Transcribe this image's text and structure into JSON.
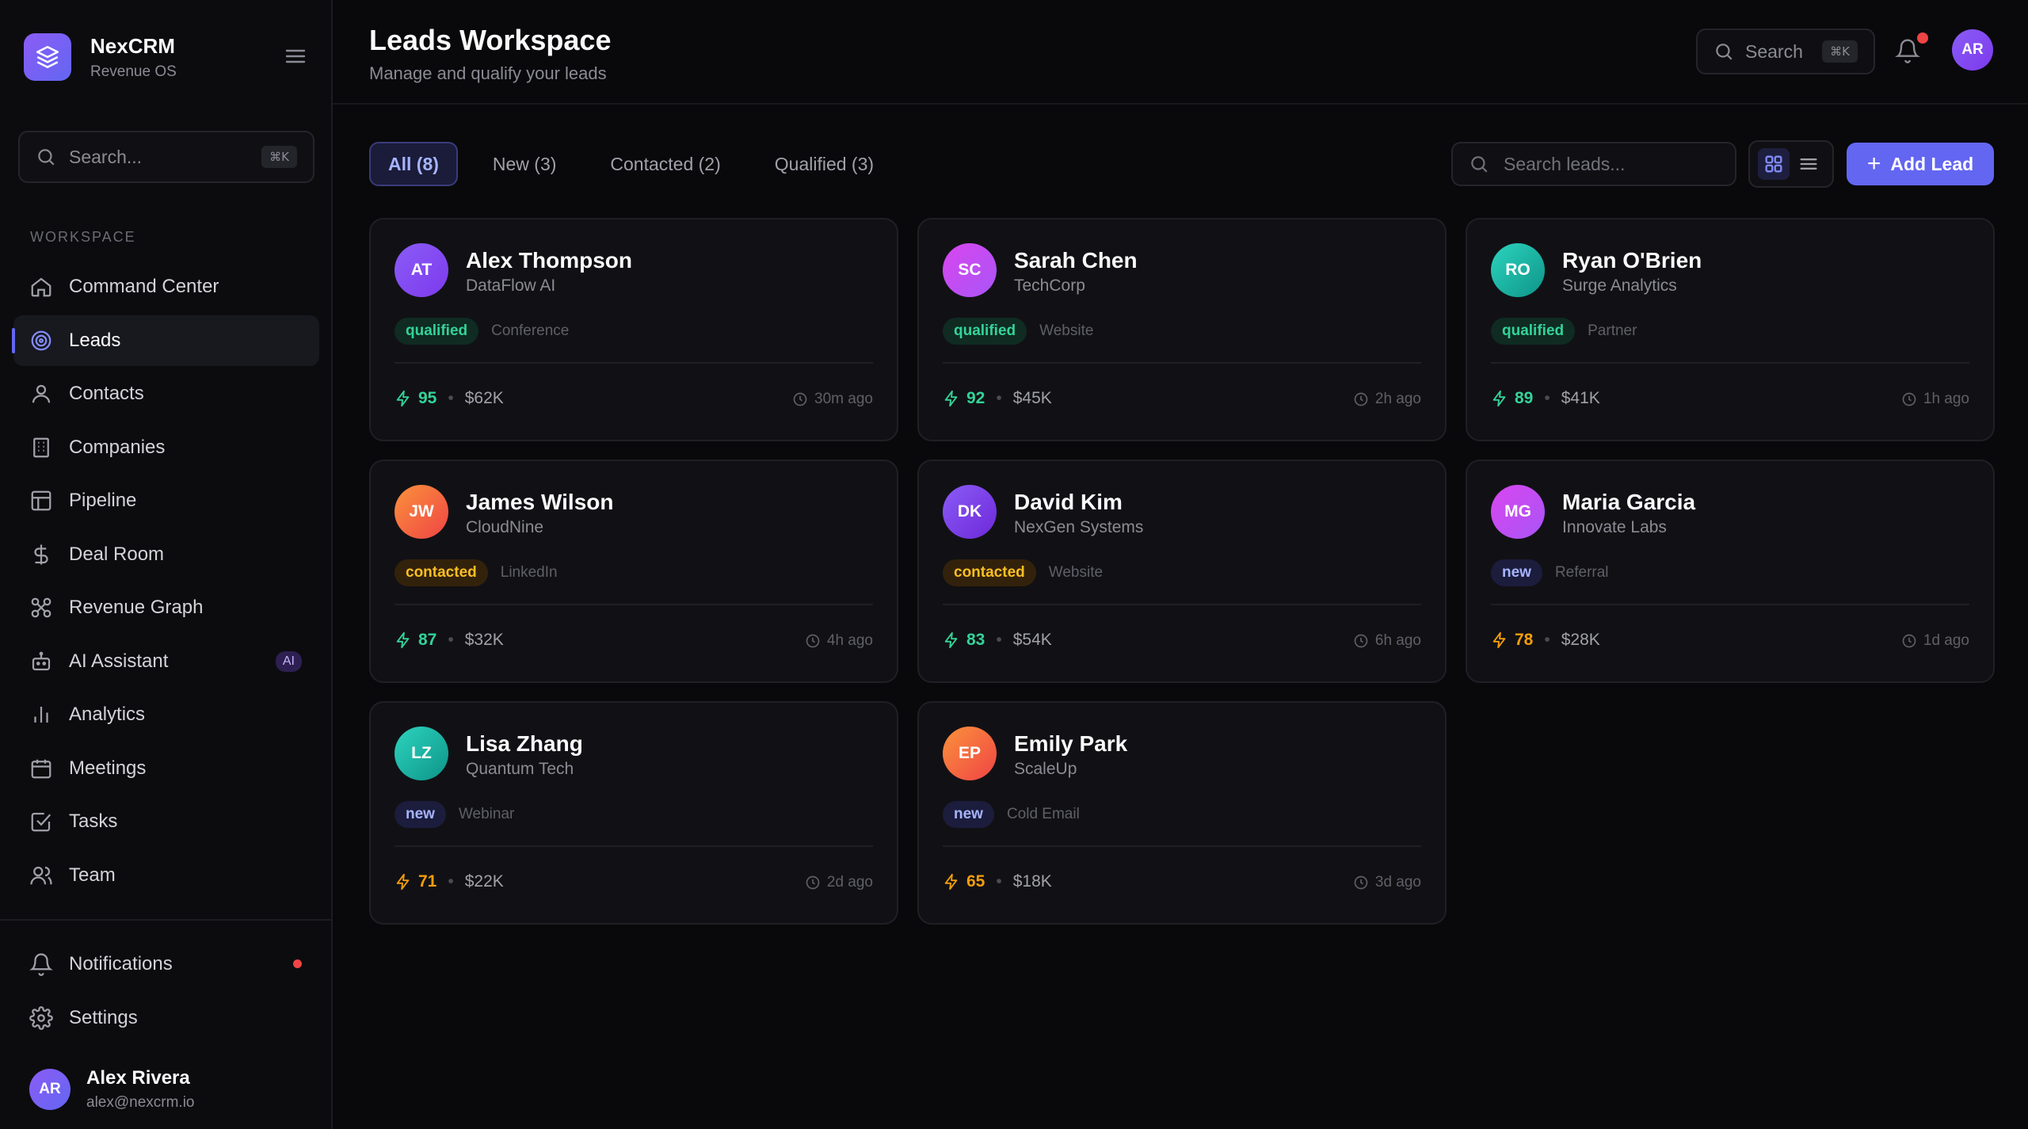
{
  "brand": {
    "name": "NexCRM",
    "subtitle": "Revenue OS"
  },
  "sidebar": {
    "search_placeholder": "Search...",
    "search_shortcut": "⌘K",
    "section_label": "WORKSPACE",
    "items": [
      {
        "label": "Command Center",
        "icon": "home-icon"
      },
      {
        "label": "Leads",
        "icon": "target-icon",
        "active": true
      },
      {
        "label": "Contacts",
        "icon": "user-icon"
      },
      {
        "label": "Companies",
        "icon": "building-icon"
      },
      {
        "label": "Pipeline",
        "icon": "layout-icon"
      },
      {
        "label": "Deal Room",
        "icon": "dollar-icon"
      },
      {
        "label": "Revenue Graph",
        "icon": "network-icon"
      },
      {
        "label": "AI Assistant",
        "icon": "bot-icon",
        "badge": "AI"
      },
      {
        "label": "Analytics",
        "icon": "bar-chart-icon"
      },
      {
        "label": "Meetings",
        "icon": "calendar-icon"
      },
      {
        "label": "Tasks",
        "icon": "check-square-icon"
      },
      {
        "label": "Team",
        "icon": "users-icon"
      }
    ],
    "bottom_items": [
      {
        "label": "Notifications",
        "icon": "bell-icon"
      },
      {
        "label": "Settings",
        "icon": "gear-icon"
      }
    ],
    "user": {
      "initials": "AR",
      "name": "Alex Rivera",
      "email": "alex@nexcrm.io"
    }
  },
  "header": {
    "title": "Leads Workspace",
    "subtitle": "Manage and qualify your leads",
    "search_label": "Search",
    "search_shortcut": "⌘K",
    "avatar_initials": "AR"
  },
  "toolbar": {
    "tabs": [
      {
        "label": "All (8)",
        "active": true
      },
      {
        "label": "New (3)"
      },
      {
        "label": "Contacted (2)"
      },
      {
        "label": "Qualified (3)"
      }
    ],
    "search_placeholder": "Search leads...",
    "add_label": "Add Lead"
  },
  "colors": {
    "accent": "#6366f1",
    "qualified": "#34d399",
    "contacted": "#fbbf24",
    "new": "#a5b4fc",
    "background": "#09090b"
  },
  "leads": [
    {
      "initials": "AT",
      "name": "Alex Thompson",
      "company": "DataFlow AI",
      "status": "qualified",
      "source": "Conference",
      "score": "95",
      "amount": "$62K",
      "time": "30m ago",
      "avatar": "linear-gradient(135deg,#8b5cf6,#7c3aed)",
      "scoreColor": "green"
    },
    {
      "initials": "SC",
      "name": "Sarah Chen",
      "company": "TechCorp",
      "status": "qualified",
      "source": "Website",
      "score": "92",
      "amount": "$45K",
      "time": "2h ago",
      "avatar": "linear-gradient(135deg,#d946ef,#a855f7)",
      "scoreColor": "green"
    },
    {
      "initials": "RO",
      "name": "Ryan O'Brien",
      "company": "Surge Analytics",
      "status": "qualified",
      "source": "Partner",
      "score": "89",
      "amount": "$41K",
      "time": "1h ago",
      "avatar": "linear-gradient(135deg,#2dd4bf,#0d9488)",
      "scoreColor": "green"
    },
    {
      "initials": "JW",
      "name": "James Wilson",
      "company": "CloudNine",
      "status": "contacted",
      "source": "LinkedIn",
      "score": "87",
      "amount": "$32K",
      "time": "4h ago",
      "avatar": "linear-gradient(135deg,#fb923c,#ef4444)",
      "scoreColor": "green"
    },
    {
      "initials": "DK",
      "name": "David Kim",
      "company": "NexGen Systems",
      "status": "contacted",
      "source": "Website",
      "score": "83",
      "amount": "$54K",
      "time": "6h ago",
      "avatar": "linear-gradient(135deg,#8b5cf6,#6d28d9)",
      "scoreColor": "green"
    },
    {
      "initials": "MG",
      "name": "Maria Garcia",
      "company": "Innovate Labs",
      "status": "new",
      "source": "Referral",
      "score": "78",
      "amount": "$28K",
      "time": "1d ago",
      "avatar": "linear-gradient(135deg,#d946ef,#a855f7)",
      "scoreColor": "amber"
    },
    {
      "initials": "LZ",
      "name": "Lisa Zhang",
      "company": "Quantum Tech",
      "status": "new",
      "source": "Webinar",
      "score": "71",
      "amount": "$22K",
      "time": "2d ago",
      "avatar": "linear-gradient(135deg,#2dd4bf,#0d9488)",
      "scoreColor": "amber"
    },
    {
      "initials": "EP",
      "name": "Emily Park",
      "company": "ScaleUp",
      "status": "new",
      "source": "Cold Email",
      "score": "65",
      "amount": "$18K",
      "time": "3d ago",
      "avatar": "linear-gradient(135deg,#fb923c,#ef4444)",
      "scoreColor": "amber"
    }
  ]
}
